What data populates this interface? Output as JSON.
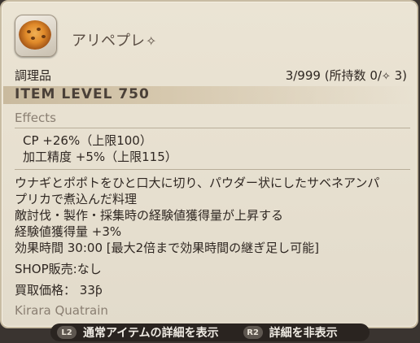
{
  "item": {
    "name": "アリペプレ",
    "hq_icon": "hq-icon",
    "category": "調理品",
    "stock": "3/999 (所持数 0/",
    "stock_hq_suffix": " 3)",
    "item_level": "ITEM LEVEL 750",
    "effects_title": "Effects",
    "effects": [
      "CP +26%（上限100）",
      "加工精度 +5%（上限115）"
    ],
    "description_lines": [
      "ウナギとポポトをひと口大に切り、パウダー状にしたサベネアンパ",
      "プリカで煮込んだ料理",
      "敵討伐・製作・採集時の経験値獲得量が上昇する",
      "経験値獲得量 +3%",
      "効果時間 30:00 [最大2倍まで効果時間の継ぎ足し可能]"
    ],
    "shop": "SHOP販売:なし",
    "sell_price_label": "買取価格：",
    "sell_price_value": "33",
    "gil_icon": "gil-icon",
    "crafter": "Kirara Quatrain"
  },
  "footer": {
    "l2_badge": "L2",
    "l2_label": "通常アイテムの詳細を表示",
    "r2_badge": "R2",
    "r2_label": "詳細を非表示"
  },
  "colors": {
    "panel_bg": "#e6dfcf",
    "text_dark": "#2f2722",
    "text_muted": "#8a7f72",
    "footer_bg": "#2a2420"
  }
}
